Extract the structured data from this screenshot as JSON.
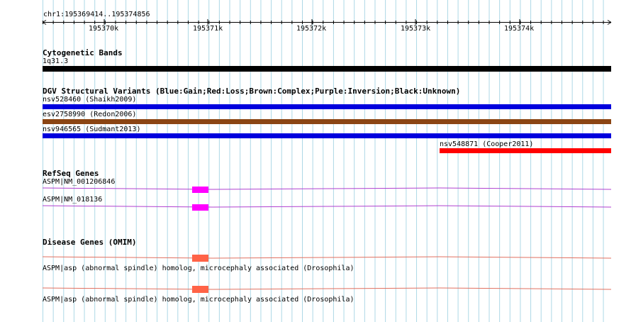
{
  "region": {
    "label": "chr1:195369414..195374856"
  },
  "ruler": {
    "ticks": [
      {
        "label": "195370k"
      },
      {
        "label": "195371k"
      },
      {
        "label": "195372k"
      },
      {
        "label": "195373k"
      },
      {
        "label": "195374k"
      }
    ]
  },
  "tracks": {
    "cytoband": {
      "title": "Cytogenetic Bands",
      "features": [
        {
          "label": "1q31.3",
          "color": "#000000"
        }
      ]
    },
    "dgv": {
      "title": "DGV Structural Variants (Blue:Gain;Red:Loss;Brown:Complex;Purple:Inversion;Black:Unknown)",
      "features": [
        {
          "label": "nsv528460 (Shaikh2009)",
          "color": "#0000dd"
        },
        {
          "label": "esv2758990 (Redon2006)",
          "color": "#8b4513"
        },
        {
          "label": "nsv946565 (Sudmant2013)",
          "color": "#0000dd"
        },
        {
          "label": "nsv548871 (Cooper2011)",
          "color": "#ff0000"
        }
      ]
    },
    "refseq": {
      "title": "RefSeq Genes",
      "features": [
        {
          "label": "ASPM|NM_001206846",
          "color": "#ff00ff",
          "line_color": "#b040d0"
        },
        {
          "label": "ASPM|NM_018136",
          "color": "#ff00ff",
          "line_color": "#b040d0"
        }
      ]
    },
    "omim": {
      "title": "Disease Genes (OMIM)",
      "features": [
        {
          "label": "ASPM|asp (abnormal spindle) homolog, microcephaly associated (Drosophila)",
          "color": "#ff6347",
          "line_color": "#e07060"
        },
        {
          "label": "ASPM|asp (abnormal spindle) homolog, microcephaly associated (Drosophila)",
          "color": "#ff6347",
          "line_color": "#e07060"
        }
      ]
    }
  },
  "colors": {
    "grid": "#add8e6",
    "ruler": "#000000"
  }
}
